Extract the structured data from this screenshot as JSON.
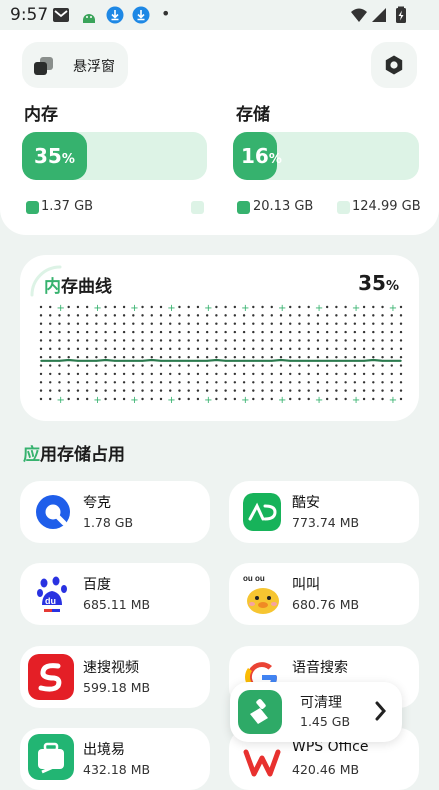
{
  "status_bar": {
    "time": "9:57",
    "dot": "•"
  },
  "header": {
    "float_label": "悬浮窗"
  },
  "memory": {
    "title": "内存",
    "percent": 35,
    "percent_text": "35",
    "used": "1.37 GB",
    "free": ""
  },
  "storage": {
    "title": "存储",
    "percent": 16,
    "percent_text": "16",
    "used": "20.13 GB",
    "total": "124.99 GB"
  },
  "pct_sign": "%",
  "chart": {
    "title": "内存曲线",
    "percent_text": "35"
  },
  "chart_data": {
    "type": "line",
    "title": "内存曲线",
    "x": [
      0,
      1,
      2,
      3,
      4,
      5,
      6,
      7,
      8,
      9,
      10,
      11,
      12,
      13,
      14,
      15,
      16,
      17,
      18,
      19,
      20,
      21,
      22,
      23,
      24,
      25,
      26,
      27,
      28,
      29,
      30,
      31,
      32,
      33,
      34,
      35,
      36,
      37,
      38,
      39
    ],
    "values": [
      35,
      35,
      35,
      36,
      35,
      35,
      35,
      36,
      35,
      35,
      35,
      35,
      36,
      35,
      35,
      35,
      35,
      35,
      35,
      36,
      35,
      35,
      35,
      35,
      35,
      35,
      36,
      35,
      35,
      35,
      35,
      35,
      35,
      35,
      35,
      35,
      36,
      35,
      35,
      35
    ],
    "ylim": [
      0,
      100
    ],
    "grid": true
  },
  "apps": {
    "title": "应用存储占用",
    "items": [
      {
        "name": "夸克",
        "size": "1.78 GB",
        "icon": "quark-icon"
      },
      {
        "name": "酷安",
        "size": "773.74 MB",
        "icon": "coolapk-icon"
      },
      {
        "name": "百度",
        "size": "685.11 MB",
        "icon": "baidu-icon"
      },
      {
        "name": "叫叫",
        "size": "680.76 MB",
        "icon": "jiaojiao-icon"
      },
      {
        "name": "速搜视频",
        "size": "599.18 MB",
        "icon": "susou-icon"
      },
      {
        "name": "语音搜索",
        "size": "",
        "icon": "google-icon"
      },
      {
        "name": "出境易",
        "size": "432.18 MB",
        "icon": "chujingyi-icon"
      },
      {
        "name": "WPS Office",
        "size": "420.46 MB",
        "icon": "wps-icon"
      }
    ]
  },
  "clean_popup": {
    "name": "可清理",
    "size": "1.45 GB"
  },
  "colors": {
    "accent": "#36b26e",
    "accent_light": "#ddf3e6",
    "background": "#eef3f1"
  }
}
